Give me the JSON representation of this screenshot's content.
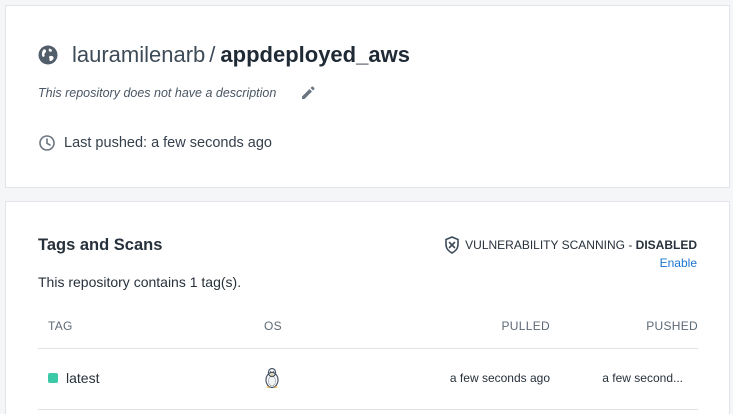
{
  "repository": {
    "owner": "lauramilenarb",
    "separator": "/",
    "name": "appdeployed_aws",
    "description": "This repository does not have a description",
    "last_pushed": "Last pushed: a few seconds ago"
  },
  "tags": {
    "title": "Tags and Scans",
    "vulnerability_label": "VULNERABILITY SCANNING",
    "vulnerability_sep": " - ",
    "vulnerability_status": "DISABLED",
    "enable_link": "Enable",
    "count_text": "This repository contains 1 tag(s).",
    "columns": {
      "tag": "TAG",
      "os": "OS",
      "pulled": "PULLED",
      "pushed": "PUSHED"
    },
    "rows": [
      {
        "tag": "latest",
        "os_icon": "linux-tux-icon",
        "pulled": "a few seconds ago",
        "pushed": "a few second..."
      }
    ]
  },
  "colors": {
    "accent": "#1c75d2",
    "tag_dot": "#3cc9a8",
    "card_border": "#e1e5e9"
  }
}
